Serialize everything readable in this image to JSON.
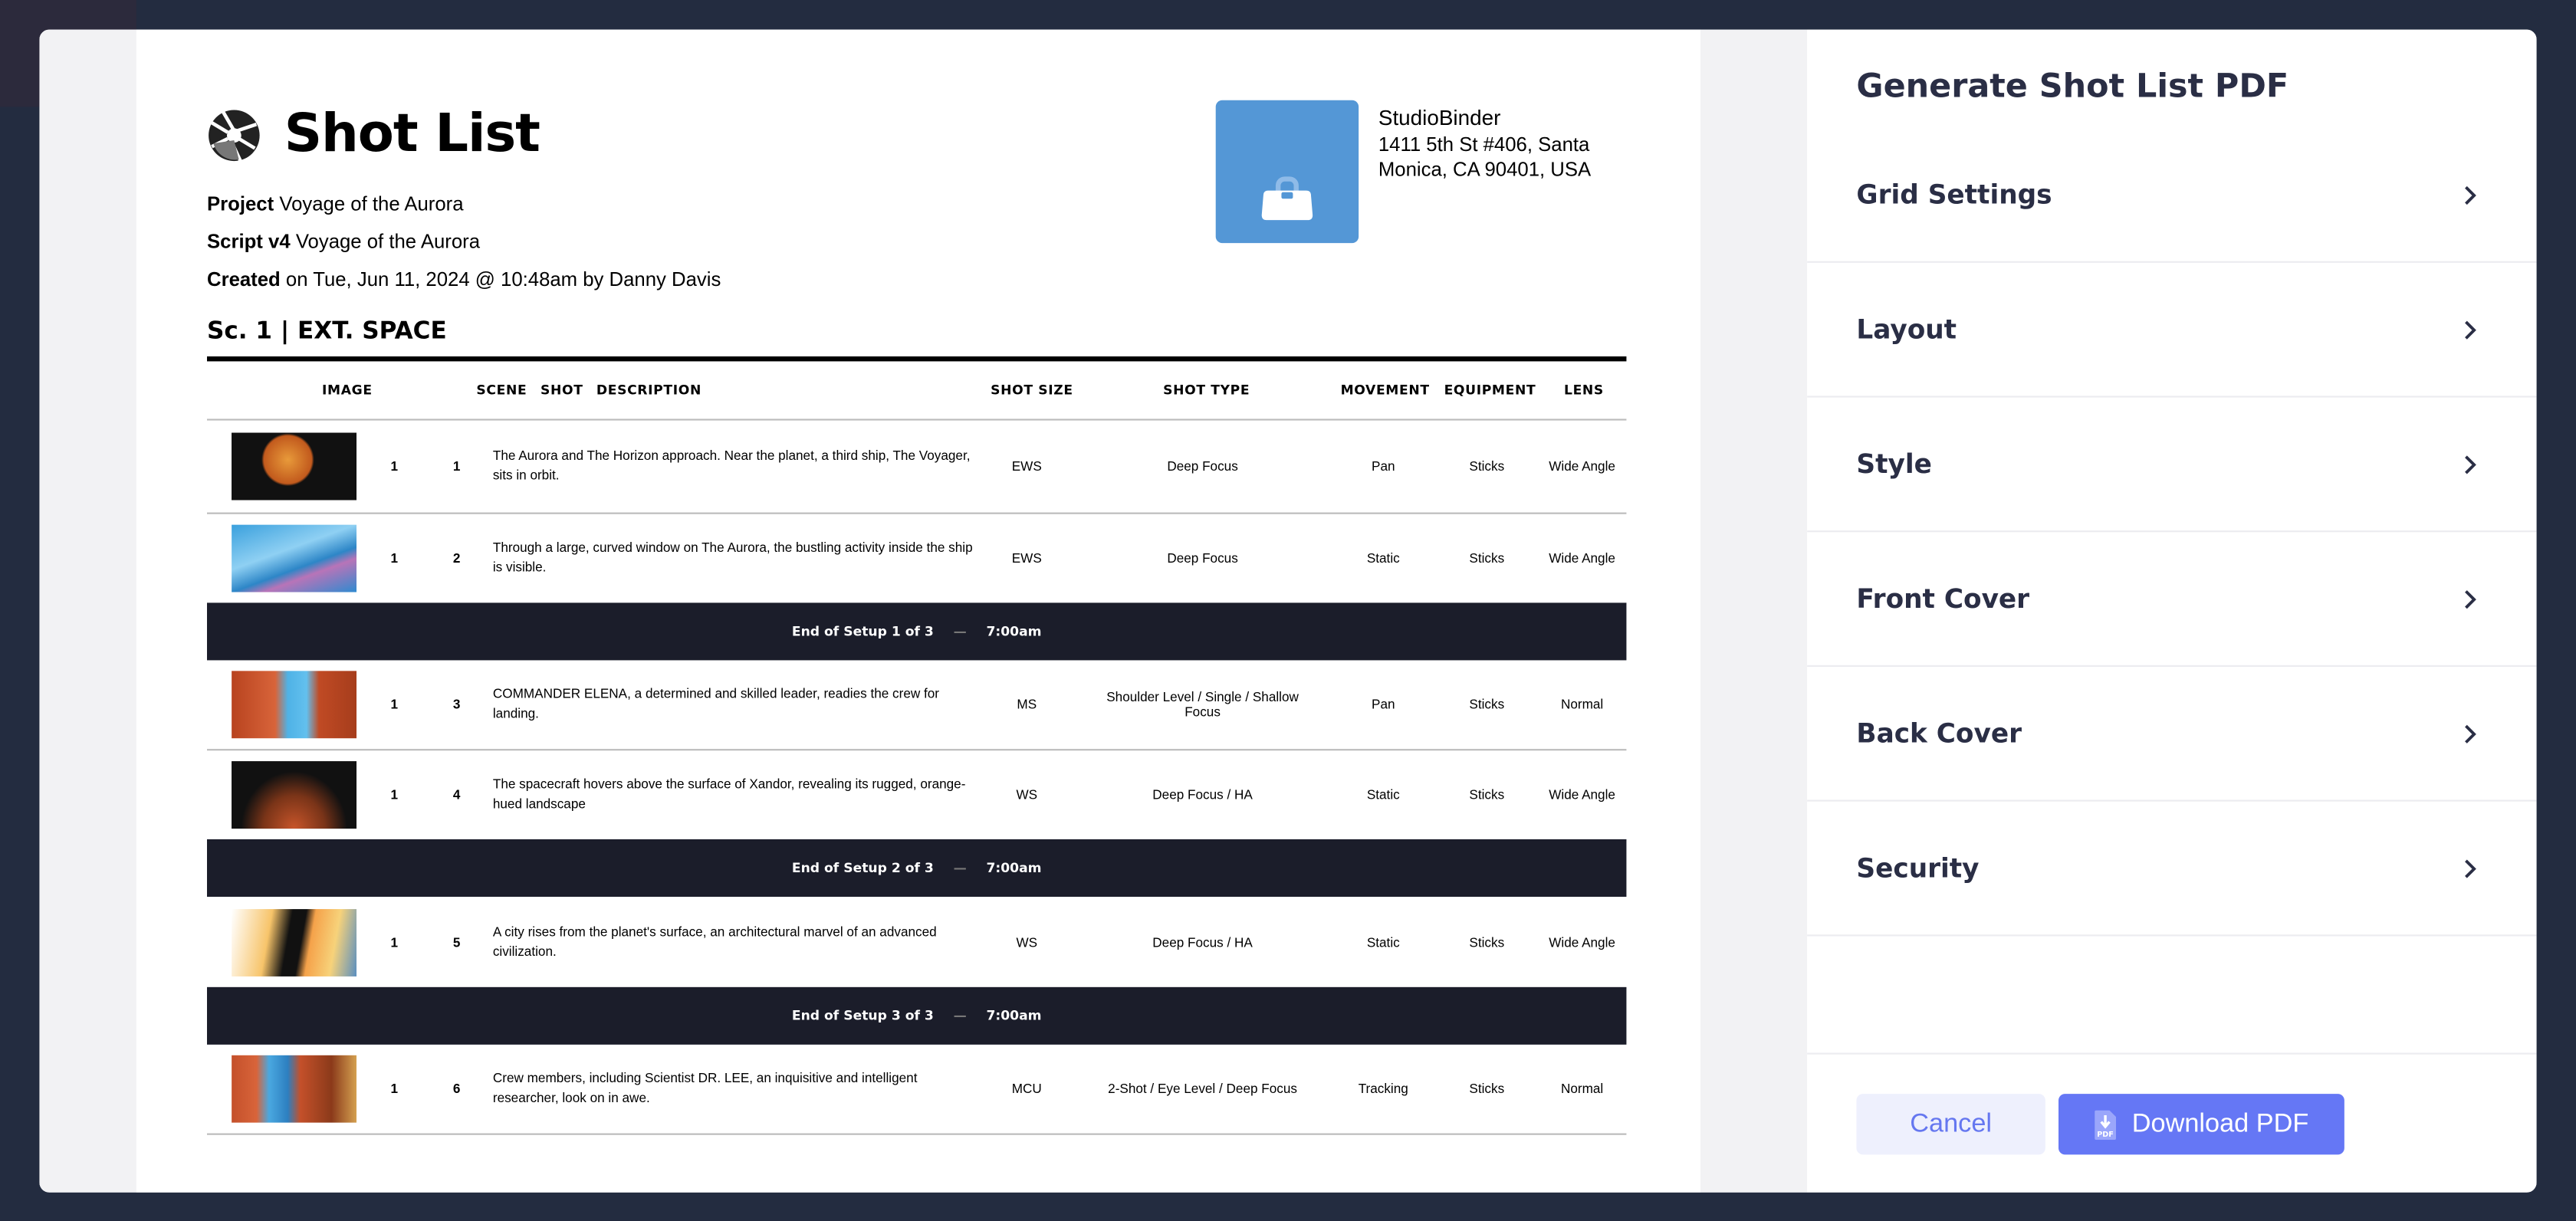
{
  "document": {
    "title": "Shot List",
    "project_label": "Project",
    "project": "Voyage of the Aurora",
    "script_label": "Script v4",
    "script": "Voyage of the Aurora",
    "created_label": "Created",
    "created": "on Tue, Jun 11, 2024 @ 10:48am by Danny Davis",
    "company": {
      "name": "StudioBinder",
      "address_line1": "1411 5th St #406, Santa",
      "address_line2": "Monica, CA 90401, USA",
      "logo_color": "#5497d6"
    },
    "scene_heading": "Sc. 1 | EXT. SPACE",
    "columns": [
      "IMAGE",
      "SCENE",
      "SHOT",
      "DESCRIPTION",
      "SHOT SIZE",
      "SHOT TYPE",
      "MOVEMENT",
      "EQUIPMENT",
      "LENS"
    ],
    "rows": [
      {
        "scene": "1",
        "shot": "1",
        "description": "The Aurora and The Horizon approach. Near the planet, a third ship, The Voyager, sits in orbit.",
        "shot_size": "EWS",
        "shot_type": "Deep Focus",
        "movement": "Pan",
        "equipment": "Sticks",
        "lens": "Wide Angle"
      },
      {
        "scene": "1",
        "shot": "2",
        "description": "Through a large, curved window on The Aurora, the bustling activity inside the ship is visible.",
        "shot_size": "EWS",
        "shot_type": "Deep Focus",
        "movement": "Static",
        "equipment": "Sticks",
        "lens": "Wide Angle"
      },
      {
        "scene": "1",
        "shot": "3",
        "description": "COMMANDER ELENA, a determined and skilled leader, readies the crew for landing.",
        "shot_size": "MS",
        "shot_type": "Shoulder Level / Single / Shallow Focus",
        "movement": "Pan",
        "equipment": "Sticks",
        "lens": "Normal"
      },
      {
        "scene": "1",
        "shot": "4",
        "description": "The spacecraft hovers above the surface of Xandor, revealing its rugged, orange-hued landscape",
        "shot_size": "WS",
        "shot_type": "Deep Focus / HA",
        "movement": "Static",
        "equipment": "Sticks",
        "lens": "Wide Angle"
      },
      {
        "scene": "1",
        "shot": "5",
        "description": "A city rises from the planet's surface, an architectural marvel of an advanced civilization.",
        "shot_size": "WS",
        "shot_type": "Deep Focus / HA",
        "movement": "Static",
        "equipment": "Sticks",
        "lens": "Wide Angle"
      },
      {
        "scene": "1",
        "shot": "6",
        "description": "Crew members, including Scientist DR. LEE, an inquisitive and intelligent researcher, look on in awe.",
        "shot_size": "MCU",
        "shot_type": "2-Shot / Eye Level / Deep Focus",
        "movement": "Tracking",
        "equipment": "Sticks",
        "lens": "Normal"
      }
    ],
    "setups": [
      {
        "label": "End of  Setup 1 of 3",
        "time": "7:00am"
      },
      {
        "label": "End of  Setup 2 of 3",
        "time": "7:00am"
      },
      {
        "label": "End of  Setup 3 of 3",
        "time": "7:00am"
      }
    ],
    "setup_separator": "—"
  },
  "panel": {
    "title": "Generate Shot List PDF",
    "items": [
      "Grid Settings",
      "Layout",
      "Style",
      "Front Cover",
      "Back Cover",
      "Security"
    ],
    "cancel_label": "Cancel",
    "download_label": "Download PDF",
    "download_icon": "pdf-download-icon",
    "accent": "#6577f5"
  }
}
